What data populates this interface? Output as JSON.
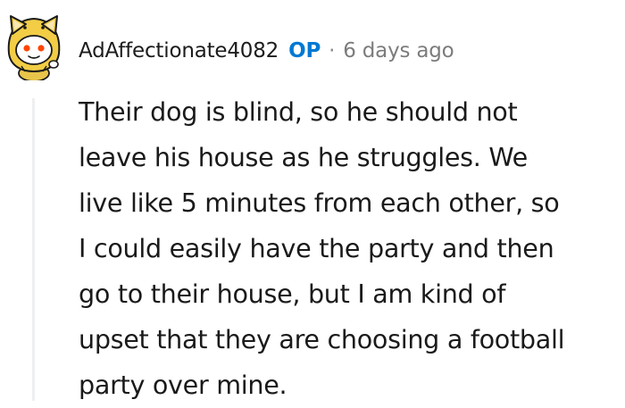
{
  "comment": {
    "author": "AdAffectionate4082",
    "op_badge": "OP",
    "separator": "·",
    "timestamp": "6 days ago",
    "body_lines": [
      "Their dog is blind, so he should not",
      "leave his house as he struggles. We",
      "live like 5 minutes from each other, so",
      "I could easily have the party and then",
      "go to their house, but I am kind of",
      "upset that they are choosing a football",
      "party over mine."
    ],
    "avatar_icon": "snoo-shiba-avatar-icon"
  },
  "colors": {
    "op_badge": "#0079d3",
    "timestamp": "#7c7c7c",
    "text": "#1a1a1a",
    "thread_line": "#edeff1"
  }
}
